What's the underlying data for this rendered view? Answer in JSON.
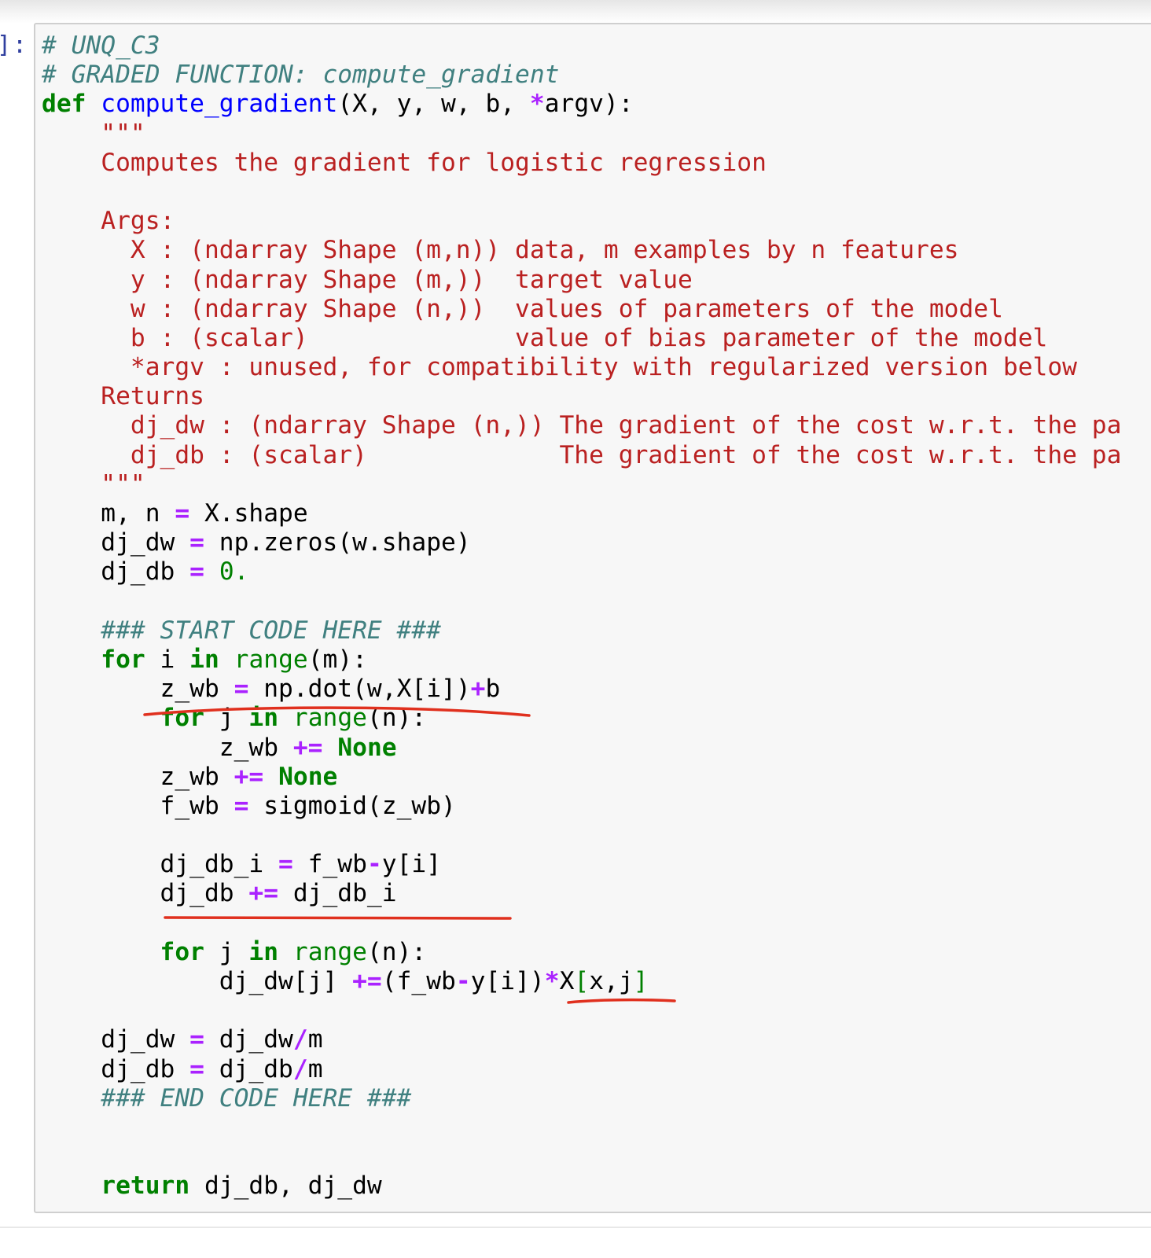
{
  "cell": {
    "prompt": "]:",
    "lines": [
      [
        {
          "t": "# UNQ_C3",
          "c": "cm"
        }
      ],
      [
        {
          "t": "# GRADED FUNCTION: compute_gradient",
          "c": "cm"
        }
      ],
      [
        {
          "t": "def",
          "c": "kw"
        },
        {
          "t": " "
        },
        {
          "t": "compute_gradient",
          "c": "fn"
        },
        {
          "t": "(X, y, w, b, "
        },
        {
          "t": "*",
          "c": "op"
        },
        {
          "t": "argv):"
        }
      ],
      [
        {
          "t": "    \"\"\"",
          "c": "st"
        }
      ],
      [
        {
          "t": "    Computes the gradient for logistic regression",
          "c": "st"
        }
      ],
      [
        {
          "t": " "
        }
      ],
      [
        {
          "t": "    Args:",
          "c": "st"
        }
      ],
      [
        {
          "t": "      X : (ndarray Shape (m,n)) data, m examples by n features",
          "c": "st"
        }
      ],
      [
        {
          "t": "      y : (ndarray Shape (m,))  target value",
          "c": "st"
        }
      ],
      [
        {
          "t": "      w : (ndarray Shape (n,))  values of parameters of the model",
          "c": "st"
        }
      ],
      [
        {
          "t": "      b : (scalar)              value of bias parameter of the model",
          "c": "st"
        }
      ],
      [
        {
          "t": "      *argv : unused, for compatibility with regularized version below",
          "c": "st"
        }
      ],
      [
        {
          "t": "    Returns",
          "c": "st"
        }
      ],
      [
        {
          "t": "      dj_dw : (ndarray Shape (n,)) The gradient of the cost w.r.t. the pa",
          "c": "st"
        }
      ],
      [
        {
          "t": "      dj_db : (scalar)             The gradient of the cost w.r.t. the pa",
          "c": "st"
        }
      ],
      [
        {
          "t": "    \"\"\"",
          "c": "st"
        }
      ],
      [
        {
          "t": "    m, n "
        },
        {
          "t": "=",
          "c": "op"
        },
        {
          "t": " X.shape"
        }
      ],
      [
        {
          "t": "    dj_dw "
        },
        {
          "t": "=",
          "c": "op"
        },
        {
          "t": " np.zeros(w.shape)"
        }
      ],
      [
        {
          "t": "    dj_db "
        },
        {
          "t": "=",
          "c": "op"
        },
        {
          "t": " "
        },
        {
          "t": "0.",
          "c": "nm"
        }
      ],
      [
        {
          "t": " "
        }
      ],
      [
        {
          "t": "    ### START CODE HERE ###",
          "c": "cm"
        }
      ],
      [
        {
          "t": "    "
        },
        {
          "t": "for",
          "c": "kw"
        },
        {
          "t": " i "
        },
        {
          "t": "in",
          "c": "kw"
        },
        {
          "t": " "
        },
        {
          "t": "range",
          "c": "bi"
        },
        {
          "t": "(m):"
        }
      ],
      [
        {
          "t": "        z_wb "
        },
        {
          "t": "=",
          "c": "op"
        },
        {
          "t": " np.dot(w,X[i])"
        },
        {
          "t": "+",
          "c": "op"
        },
        {
          "t": "b"
        }
      ],
      [
        {
          "t": "        "
        },
        {
          "t": "for",
          "c": "kw"
        },
        {
          "t": " j "
        },
        {
          "t": "in",
          "c": "kw"
        },
        {
          "t": " "
        },
        {
          "t": "range",
          "c": "bi"
        },
        {
          "t": "(n):"
        }
      ],
      [
        {
          "t": "            z_wb "
        },
        {
          "t": "+=",
          "c": "op"
        },
        {
          "t": " "
        },
        {
          "t": "None",
          "c": "kw"
        }
      ],
      [
        {
          "t": "        z_wb "
        },
        {
          "t": "+=",
          "c": "op"
        },
        {
          "t": " "
        },
        {
          "t": "None",
          "c": "kw"
        }
      ],
      [
        {
          "t": "        f_wb "
        },
        {
          "t": "=",
          "c": "op"
        },
        {
          "t": " sigmoid(z_wb)"
        }
      ],
      [
        {
          "t": " "
        }
      ],
      [
        {
          "t": "        dj_db_i "
        },
        {
          "t": "=",
          "c": "op"
        },
        {
          "t": " f_wb"
        },
        {
          "t": "-",
          "c": "op"
        },
        {
          "t": "y[i]"
        }
      ],
      [
        {
          "t": "        dj_db "
        },
        {
          "t": "+=",
          "c": "op"
        },
        {
          "t": " dj_db_i"
        }
      ],
      [
        {
          "t": " "
        }
      ],
      [
        {
          "t": "        "
        },
        {
          "t": "for",
          "c": "kw"
        },
        {
          "t": " j "
        },
        {
          "t": "in",
          "c": "kw"
        },
        {
          "t": " "
        },
        {
          "t": "range",
          "c": "bi"
        },
        {
          "t": "(n):"
        }
      ],
      [
        {
          "t": "            dj_dw[j] "
        },
        {
          "t": "+=",
          "c": "op"
        },
        {
          "t": "(f_wb"
        },
        {
          "t": "-",
          "c": "op"
        },
        {
          "t": "y[i])"
        },
        {
          "t": "*",
          "c": "op"
        },
        {
          "t": "X"
        },
        {
          "t": "[",
          "c": "br"
        },
        {
          "t": "x,j"
        },
        {
          "t": "]",
          "c": "br"
        }
      ],
      [
        {
          "t": " "
        }
      ],
      [
        {
          "t": "    dj_dw "
        },
        {
          "t": "=",
          "c": "op"
        },
        {
          "t": " dj_dw"
        },
        {
          "t": "/",
          "c": "op"
        },
        {
          "t": "m"
        }
      ],
      [
        {
          "t": "    dj_db "
        },
        {
          "t": "=",
          "c": "op"
        },
        {
          "t": " dj_db"
        },
        {
          "t": "/",
          "c": "op"
        },
        {
          "t": "m"
        }
      ],
      [
        {
          "t": "    ### END CODE HERE ###",
          "c": "cm"
        }
      ],
      [
        {
          "t": " "
        }
      ],
      [
        {
          "t": " "
        }
      ],
      [
        {
          "t": "    "
        },
        {
          "t": "return",
          "c": "kw"
        },
        {
          "t": " dj_db, dj_dw"
        }
      ]
    ]
  },
  "colors": {
    "annotation": "#e0301e",
    "keyword": "#008000",
    "function": "#0000ff",
    "operator": "#aa22ff",
    "comment": "#408080",
    "string": "#ba2121",
    "prompt": "#303f9f"
  }
}
